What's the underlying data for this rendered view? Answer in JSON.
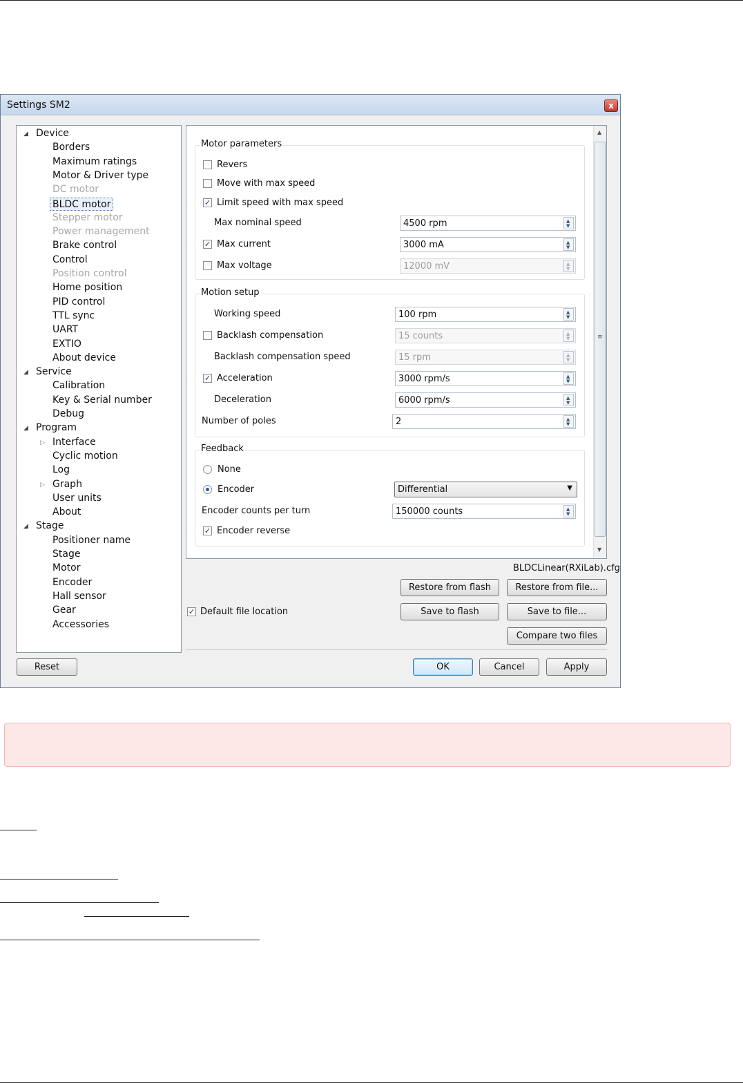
{
  "window": {
    "title": "Settings SM2",
    "close_label": "x"
  },
  "tree": {
    "items": [
      {
        "label": "Device",
        "level": 0,
        "expander": "expanded",
        "state": "normal"
      },
      {
        "label": "Borders",
        "level": 1,
        "state": "normal"
      },
      {
        "label": "Maximum ratings",
        "level": 1,
        "state": "normal"
      },
      {
        "label": "Motor & Driver type",
        "level": 1,
        "state": "normal"
      },
      {
        "label": "DC motor",
        "level": 1,
        "state": "disabled"
      },
      {
        "label": "BLDC motor",
        "level": 1,
        "state": "selected"
      },
      {
        "label": "Stepper motor",
        "level": 1,
        "state": "disabled"
      },
      {
        "label": "Power management",
        "level": 1,
        "state": "disabled"
      },
      {
        "label": "Brake control",
        "level": 1,
        "state": "normal"
      },
      {
        "label": "Control",
        "level": 1,
        "state": "normal"
      },
      {
        "label": "Position control",
        "level": 1,
        "state": "disabled"
      },
      {
        "label": "Home position",
        "level": 1,
        "state": "normal"
      },
      {
        "label": "PID control",
        "level": 1,
        "state": "normal"
      },
      {
        "label": "TTL sync",
        "level": 1,
        "state": "normal"
      },
      {
        "label": "UART",
        "level": 1,
        "state": "normal"
      },
      {
        "label": "EXTIO",
        "level": 1,
        "state": "normal"
      },
      {
        "label": "About device",
        "level": 1,
        "state": "normal"
      },
      {
        "label": "Service",
        "level": 0,
        "expander": "expanded",
        "state": "normal"
      },
      {
        "label": "Calibration",
        "level": 1,
        "state": "normal"
      },
      {
        "label": "Key & Serial number",
        "level": 1,
        "state": "normal"
      },
      {
        "label": "Debug",
        "level": 1,
        "state": "normal"
      },
      {
        "label": "Program",
        "level": 0,
        "expander": "expanded",
        "state": "normal"
      },
      {
        "label": "Interface",
        "level": 1,
        "expander": "collapsed",
        "state": "normal"
      },
      {
        "label": "Cyclic motion",
        "level": 1,
        "state": "normal"
      },
      {
        "label": "Log",
        "level": 1,
        "state": "normal"
      },
      {
        "label": "Graph",
        "level": 1,
        "expander": "collapsed",
        "state": "normal"
      },
      {
        "label": "User units",
        "level": 1,
        "state": "normal"
      },
      {
        "label": "About",
        "level": 1,
        "state": "normal"
      },
      {
        "label": "Stage",
        "level": 0,
        "expander": "expanded",
        "state": "normal"
      },
      {
        "label": "Positioner name",
        "level": 1,
        "state": "normal"
      },
      {
        "label": "Stage",
        "level": 1,
        "state": "normal"
      },
      {
        "label": "Motor",
        "level": 1,
        "state": "normal"
      },
      {
        "label": "Encoder",
        "level": 1,
        "state": "normal"
      },
      {
        "label": "Hall sensor",
        "level": 1,
        "state": "normal"
      },
      {
        "label": "Gear",
        "level": 1,
        "state": "normal"
      },
      {
        "label": "Accessories",
        "level": 1,
        "state": "normal"
      }
    ]
  },
  "motor_parameters": {
    "title": "Motor parameters",
    "revers": {
      "label": "Revers",
      "checked": false
    },
    "move_max_speed": {
      "label": "Move with max speed",
      "checked": false
    },
    "limit_speed": {
      "label": "Limit speed with max speed",
      "checked": true
    },
    "max_nominal_speed": {
      "label": "Max nominal speed",
      "value": "4500 rpm"
    },
    "max_current": {
      "label": "Max current",
      "checked": true,
      "value": "3000 mA"
    },
    "max_voltage": {
      "label": "Max voltage",
      "checked": false,
      "value": "12000 mV"
    }
  },
  "motion_setup": {
    "title": "Motion setup",
    "working_speed": {
      "label": "Working speed",
      "value": "100 rpm"
    },
    "backlash": {
      "label": "Backlash compensation",
      "checked": false,
      "value": "15 counts"
    },
    "backlash_speed": {
      "label": "Backlash compensation speed",
      "value": "15 rpm"
    },
    "acceleration": {
      "label": "Acceleration",
      "checked": true,
      "value": "3000 rpm/s"
    },
    "deceleration": {
      "label": "Deceleration",
      "value": "6000 rpm/s"
    },
    "poles": {
      "label": "Number of poles",
      "value": "2"
    }
  },
  "feedback": {
    "title": "Feedback",
    "none": {
      "label": "None",
      "selected": false
    },
    "encoder": {
      "label": "Encoder",
      "selected": true,
      "type": "Differential"
    },
    "counts": {
      "label": "Encoder counts per turn",
      "value": "150000 counts"
    },
    "reverse": {
      "label": "Encoder reverse",
      "checked": true
    }
  },
  "files": {
    "filename": "BLDCLinear(RXiLab).cfg",
    "default_location": {
      "label": "Default file location",
      "checked": true
    },
    "restore_flash": "Restore from flash",
    "restore_file": "Restore from file...",
    "save_flash": "Save to flash",
    "save_file": "Save to file...",
    "compare": "Compare two files"
  },
  "footer": {
    "reset": "Reset",
    "ok": "OK",
    "cancel": "Cancel",
    "apply": "Apply"
  },
  "colors": {
    "accent": "#3c7fb1",
    "alert_bg": "#fde7e7",
    "check": "#1e3e7a"
  }
}
